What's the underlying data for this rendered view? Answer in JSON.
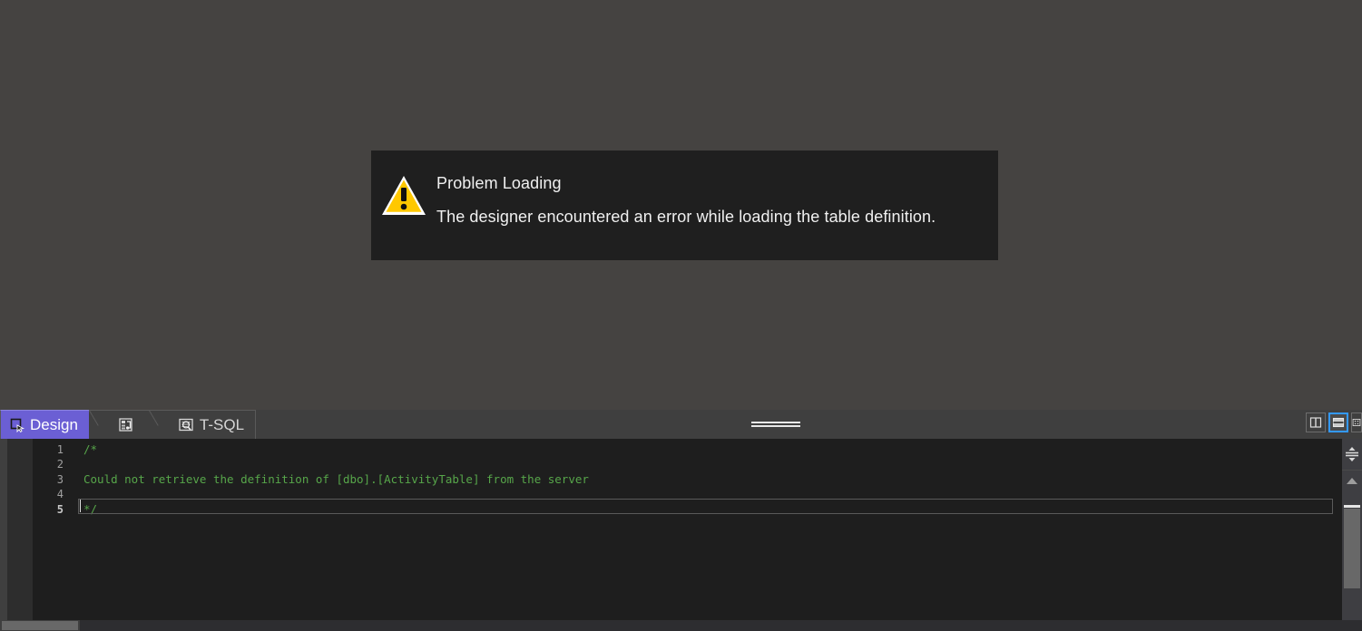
{
  "problem_dialog": {
    "icon": "warning-triangle-icon",
    "title": "Problem Loading",
    "message": "The designer encountered an error while loading the table definition.",
    "background_color": "#1f1f1f",
    "icon_color": "#ffc800"
  },
  "editor_panel": {
    "tabs": [
      {
        "id": "design",
        "label": "Design",
        "icon": "design-surface-icon",
        "active": true
      },
      {
        "id": "column-designer",
        "label": "",
        "icon": "column-designer-icon",
        "active": false
      },
      {
        "id": "tsql",
        "label": "T-SQL",
        "icon": "tsql-script-icon",
        "active": false
      }
    ],
    "active_tab_color": "#6b5fd4",
    "splitter_grip": "pane-splitter-grip",
    "view_modes": [
      {
        "id": "split-vertical",
        "icon": "split-vertical-icon",
        "active": false
      },
      {
        "id": "split-horizontal",
        "icon": "split-horizontal-icon",
        "active": true
      },
      {
        "id": "more-view-options",
        "icon": "view-options-icon",
        "active": false
      }
    ],
    "code": {
      "language": "T-SQL",
      "comment_color": "#57a64a",
      "current_line": 5,
      "lines": [
        {
          "number": "1",
          "text": "/*"
        },
        {
          "number": "2",
          "text": ""
        },
        {
          "number": "3",
          "text": "Could not retrieve the definition of [dbo].[ActivityTable] from the server"
        },
        {
          "number": "4",
          "text": ""
        },
        {
          "number": "5",
          "text": "*/"
        }
      ]
    },
    "scrollbars": {
      "vertical": {
        "up_arrow": "scroll-up-arrow-icon",
        "down_arrow": "scroll-down-arrow-icon",
        "split_handle": "editor-split-handle-icon"
      },
      "horizontal": {
        "present": true
      }
    }
  }
}
